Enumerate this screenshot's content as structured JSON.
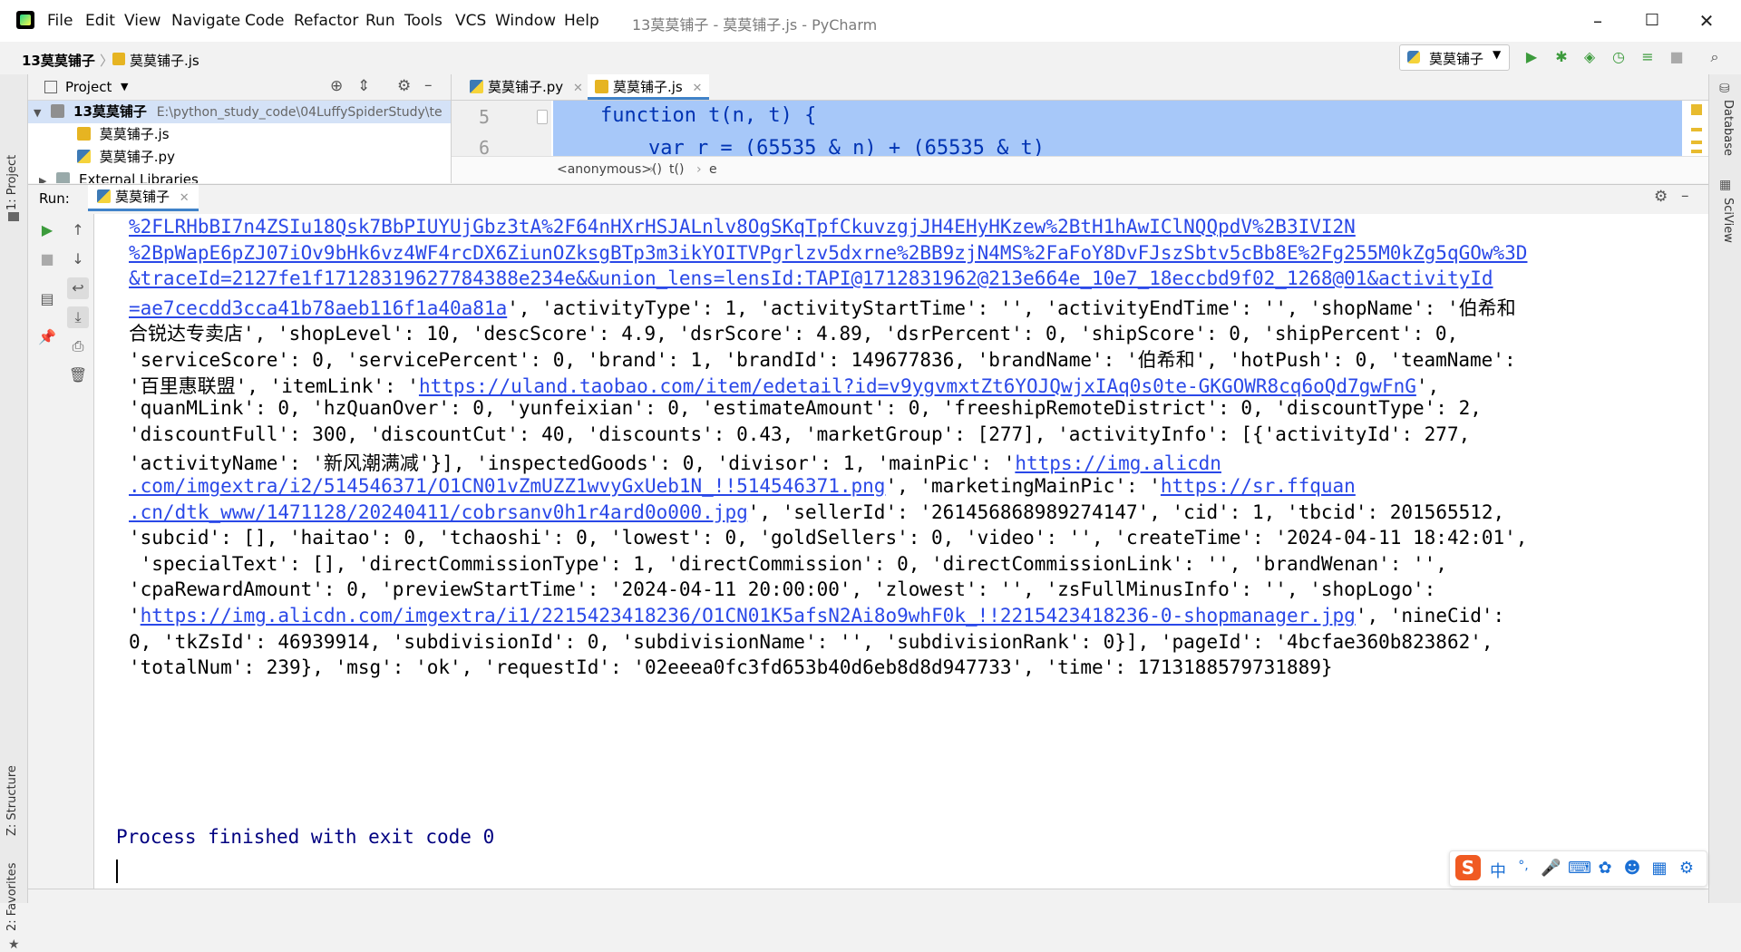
{
  "window": {
    "menu": [
      "File",
      "Edit",
      "View",
      "Navigate",
      "Code",
      "Refactor",
      "Run",
      "Tools",
      "VCS",
      "Window",
      "Help"
    ],
    "title": "13莫莫铺子 - 莫莫铺子.js - PyCharm",
    "minimize": "–",
    "maximize": "☐",
    "close": "✕"
  },
  "navbar": {
    "project": "13莫莫铺子",
    "file": "莫莫铺子.js",
    "run_config": "莫莫铺子"
  },
  "left_stripe": {
    "project_tab": "1: Project",
    "structure_tab": "Z: Structure",
    "favorites_tab": "2: Favorites"
  },
  "right_stripe": {
    "database_tab": "Database",
    "sciview_tab": "SciView"
  },
  "project_panel": {
    "title": "Project",
    "root_name": "13莫莫铺子",
    "root_path": "E:\\python_study_code\\04LuffySpiderStudy\\te",
    "files": [
      "莫莫铺子.js",
      "莫莫铺子.py"
    ],
    "external": "External Libraries"
  },
  "editor": {
    "tabs": [
      "莫莫铺子.py",
      "莫莫铺子.js"
    ],
    "line5_no": "5",
    "line6_no": "6",
    "line5": "    function t(n, t) {",
    "line6": "        var r = (65535 & n) + (65535 & t)",
    "breadcrumbs": [
      "<anonymous>()",
      "t()",
      "e"
    ]
  },
  "run": {
    "label": "Run:",
    "tab": "莫莫铺子"
  },
  "console": {
    "lines": [
      [
        {
          "t": "%2FLRHbBI7n4ZSIu18Qsk7BbPIUYUjGbz3tA%2F64nHXrHSJALnlv8OgSKqTpfCkuvzgjJH4EHyHKzew%2BtH1hAwIClNQQpdV%2B3IVI2N",
          "l": true
        }
      ],
      [
        {
          "t": "%2BpWapE6pZJ07iOv9bHk6vz4WF4rcDX6ZiunOZksgBTp3m3ikYOITVPgrlzv5dxrne%2BB9zjN4MS%2FaFoY8DvFJszSbtv5cBb8E%2Fg255M0kZg5qGOw%3D",
          "l": true
        }
      ],
      [
        {
          "t": "&traceId=2127fe1f17128319627784388e234e&&union_lens=lensId:TAPI@1712831962@213e664e_10e7_18eccbd9f02_1268@01&activityId",
          "l": true
        }
      ],
      [
        {
          "t": "=ae7cecdd3cca41b78aeb116f1a40a81a",
          "l": true
        },
        {
          "t": "', 'activityType': 1, 'activityStartTime': '', 'activityEndTime': '', 'shopName': '伯希和",
          "l": false
        }
      ],
      [
        {
          "t": "合锐达专卖店', 'shopLevel': 10, 'descScore': 4.9, 'dsrScore': 4.89, 'dsrPercent': 0, 'shipScore': 0, 'shipPercent': 0,",
          "l": false
        }
      ],
      [
        {
          "t": "'serviceScore': 0, 'servicePercent': 0, 'brand': 1, 'brandId': 149677836, 'brandName': '伯希和', 'hotPush': 0, 'teamName':",
          "l": false
        }
      ],
      [
        {
          "t": "'百里惠联盟', 'itemLink': '",
          "l": false
        },
        {
          "t": "https://uland.taobao.com/item/edetail?id=v9ygvmxtZt6YOJQwjxIAq0s0te-GKGOWR8cq6oQd7gwFnG",
          "l": true
        },
        {
          "t": "',",
          "l": false
        }
      ],
      [
        {
          "t": "'quanMLink': 0, 'hzQuanOver': 0, 'yunfeixian': 0, 'estimateAmount': 0, 'freeshipRemoteDistrict': 0, 'discountType': 2,",
          "l": false
        }
      ],
      [
        {
          "t": "'discountFull': 300, 'discountCut': 40, 'discounts': 0.43, 'marketGroup': [277], 'activityInfo': [{'activityId': 277,",
          "l": false
        }
      ],
      [
        {
          "t": "'activityName': '新风潮满减'}], 'inspectedGoods': 0, 'divisor': 1, 'mainPic': '",
          "l": false
        },
        {
          "t": "https://img.alicdn",
          "l": true
        }
      ],
      [
        {
          "t": ".com/imgextra/i2/514546371/O1CN01vZmUZZ1wvyGxUeb1N_!!514546371.png",
          "l": true
        },
        {
          "t": "', 'marketingMainPic': '",
          "l": false
        },
        {
          "t": "https://sr.ffquan",
          "l": true
        }
      ],
      [
        {
          "t": ".cn/dtk_www/1471128/20240411/cobrsanv0h1r4ard0o000.jpg",
          "l": true
        },
        {
          "t": "', 'sellerId': '261456868989274147', 'cid': 1, 'tbcid': 201565512,",
          "l": false
        }
      ],
      [
        {
          "t": "'subcid': [], 'haitao': 0, 'tchaoshi': 0, 'lowest': 0, 'goldSellers': 0, 'video': '', 'createTime': '2024-04-11 18:42:01',",
          "l": false
        }
      ],
      [
        {
          "t": " 'specialText': [], 'directCommissionType': 1, 'directCommission': 0, 'directCommissionLink': '', 'brandWenan': '',",
          "l": false
        }
      ],
      [
        {
          "t": "'cpaRewardAmount': 0, 'previewStartTime': '2024-04-11 20:00:00', 'zlowest': '', 'zsFullMinusInfo': '', 'shopLogo':",
          "l": false
        }
      ],
      [
        {
          "t": "'",
          "l": false
        },
        {
          "t": "https://img.alicdn.com/imgextra/i1/2215423418236/O1CN01K5afsN2Ai8o9whF0k_!!2215423418236-0-shopmanager.jpg",
          "l": true
        },
        {
          "t": "', 'nineCid':",
          "l": false
        }
      ],
      [
        {
          "t": "0, 'tkZsId': 46939914, 'subdivisionId': 0, 'subdivisionName': '', 'subdivisionRank': 0}], 'pageId': '4bcfae360b823862',",
          "l": false
        }
      ],
      [
        {
          "t": "'totalNum': 239}, 'msg': 'ok', 'requestId': '02eeea0fc3fd653b40d6eb8d8d947733', 'time': 1713188579731889}",
          "l": false
        }
      ]
    ],
    "process": "Process finished with exit code 0"
  },
  "ime": {
    "logo": "S",
    "mode": "中",
    "punct": "°,"
  },
  "colors": {
    "accent": "#4083c9",
    "link": "#2a48e8",
    "selection": "#a7c8f9",
    "run_green": "#3c9b3c"
  }
}
